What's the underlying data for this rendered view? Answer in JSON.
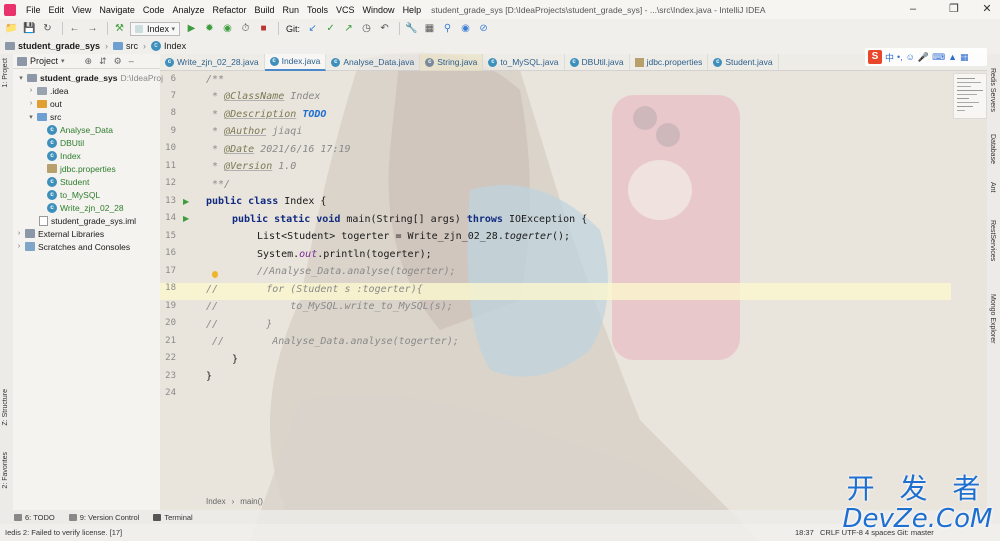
{
  "window": {
    "title": "student_grade_sys [D:\\IdeaProjects\\student_grade_sys] - ...\\src\\Index.java - IntelliJ IDEA",
    "menus": [
      "File",
      "Edit",
      "View",
      "Navigate",
      "Code",
      "Analyze",
      "Refactor",
      "Build",
      "Run",
      "Tools",
      "VCS",
      "Window",
      "Help"
    ]
  },
  "toolbar": {
    "run_config": "Index",
    "git_label": "Git:"
  },
  "navbar": {
    "crumbs": [
      "student_grade_sys",
      "src",
      "Index"
    ]
  },
  "left_strip": {
    "project": "1: Project",
    "structure": "Z: Structure",
    "favorites": "2: Favorites"
  },
  "right_strip": {
    "items": [
      "Redis Servers",
      "Database",
      "Ant",
      "RestServices",
      "Mongo Explorer"
    ]
  },
  "project_panel": {
    "header": "Project",
    "root": "student_grade_sys",
    "root_path": "D:\\IdeaProj",
    "items": {
      "idea": ".idea",
      "out": "out",
      "src": "src",
      "analyse": "Analyse_Data",
      "dbutil": "DBUtil",
      "index": "Index",
      "jdbc": "jdbc.properties",
      "student": "Student",
      "tomysql": "to_MySQL",
      "write": "Write_zjn_02_28",
      "iml": "student_grade_sys.iml",
      "extlib": "External Libraries",
      "scratches": "Scratches and Consoles"
    }
  },
  "tabs": [
    "Write_zjn_02_28.java",
    "Index.java",
    "Analyse_Data.java",
    "String.java",
    "to_MySQL.java",
    "DBUtil.java",
    "jdbc.properties",
    "Student.java"
  ],
  "editor": {
    "line_numbers": [
      "6",
      "7",
      "8",
      "9",
      "10",
      "11",
      "12",
      "13",
      "14",
      "15",
      "16",
      "17",
      "18",
      "19",
      "20",
      "21",
      "22",
      "23",
      "24"
    ],
    "lines": {
      "l6": "/**",
      "l7_tag": "@ClassName",
      "l7_val": " Index",
      "l8_tag": "@Description",
      "l8_val": "TODO",
      "l9_tag": "@Author",
      "l9_val": " jiaqi",
      "l10_tag": "@Date",
      "l10_val": " 2021/6/16 17:19",
      "l11_tag": "@Version",
      "l11_val": " 1.0",
      "l12": " **/",
      "l13_kw": "public class",
      "l13_rest": " Index {",
      "l14_kw1": "public static void",
      "l14_mid": " main(String[] args) ",
      "l14_kw2": "throws",
      "l14_rest": " IOException {",
      "l15_a": "List<Student> togerter = Write_zjn_02_28.",
      "l15_fn": "togerter",
      "l15_b": "();",
      "l16_a": "System.",
      "l16_field": "out",
      "l16_b": ".println(togerter);",
      "l17": "//Analyse_Data.analyse(togerter);",
      "l18": "//        for (Student s :togerter){",
      "l19": "//            to_MySQL.write_to_MySQL(s);",
      "l20": "//        }",
      "l21": " //        Analyse_Data.analyse(togerter);",
      "l22": "}",
      "l23": "}"
    },
    "breadcrumb": [
      "Index",
      "main()"
    ]
  },
  "bottom_tabs": [
    "6: TODO",
    "9: Version Control",
    "Terminal"
  ],
  "status": {
    "message": "Iedis 2: Failed to verify license. [17]",
    "position": "18:37",
    "extra": "CRLF  UTF-8  4 spaces  Git: master"
  },
  "ime": {
    "zh": "中"
  },
  "watermark": {
    "line1": "开 发 者",
    "line2": "DevZe.CoM"
  },
  "colors": {
    "keyword": "#0f2a80",
    "comment": "#8a8a8a",
    "todo": "#1f6fd1",
    "watermark": "#1e6fcf"
  }
}
